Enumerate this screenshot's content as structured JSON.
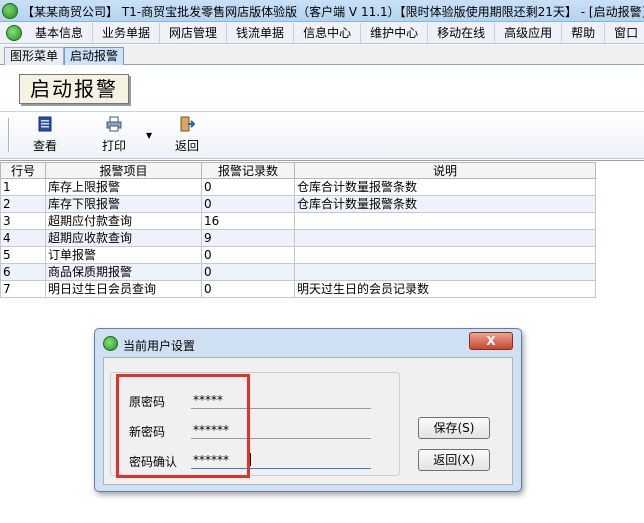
{
  "window": {
    "title": "【某某商贸公司】 T1-商贸宝批发零售网店版体验版（客户端 V 11.1）【限时体验版使用期限还剩21天】 - [启动报警]"
  },
  "menu": {
    "items": [
      "基本信息",
      "业务单据",
      "网店管理",
      "钱流单据",
      "信息中心",
      "维护中心",
      "移动在线",
      "高级应用",
      "帮助",
      "窗口"
    ]
  },
  "tabs": [
    "图形菜单",
    "启动报警"
  ],
  "page": {
    "caption": "启动报警"
  },
  "toolbar": {
    "view_label": "查看",
    "print_label": "打印",
    "back_label": "返回"
  },
  "grid": {
    "headers": [
      "行号",
      "报警项目",
      "报警记录数",
      "说明"
    ],
    "rows": [
      [
        "1",
        "库存上限报警",
        "0",
        "仓库合计数量报警条数"
      ],
      [
        "2",
        "库存下限报警",
        "0",
        "仓库合计数量报警条数"
      ],
      [
        "3",
        "超期应付款查询",
        "16",
        ""
      ],
      [
        "4",
        "超期应收款查询",
        "9",
        ""
      ],
      [
        "5",
        "订单报警",
        "0",
        ""
      ],
      [
        "6",
        "商品保质期报警",
        "0",
        ""
      ],
      [
        "7",
        "明日过生日会员查询",
        "0",
        "明天过生日的会员记录数"
      ]
    ]
  },
  "dialog": {
    "title": "当前用户设置",
    "close_label": "X",
    "fields": [
      {
        "label": "原密码",
        "value": "*****"
      },
      {
        "label": "新密码",
        "value": "******"
      },
      {
        "label": "密码确认",
        "value": "******"
      }
    ],
    "save_label": "保存(S)",
    "back_label": "返回(X)"
  },
  "colors": {
    "highlight_box": "#e0332a",
    "dialog_background": "#cfe0f3",
    "row_alt": "#eef3fb"
  }
}
